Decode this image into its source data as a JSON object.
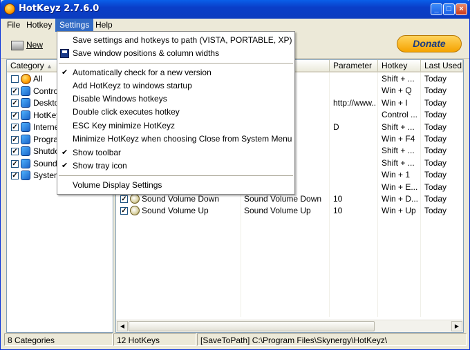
{
  "window": {
    "title": "HotKeyz 2.7.6.0"
  },
  "menubar": {
    "items": [
      "File",
      "Hotkey",
      "Settings",
      "Help"
    ]
  },
  "toolbar": {
    "new_label": "New",
    "donate_label": "Donate"
  },
  "categories": {
    "header": "Category",
    "items": [
      {
        "label": "All",
        "checked": false
      },
      {
        "label": "Contro",
        "checked": true
      },
      {
        "label": "Deskto",
        "checked": true
      },
      {
        "label": "HotKey",
        "checked": true
      },
      {
        "label": "Interne",
        "checked": true
      },
      {
        "label": "Progra",
        "checked": true
      },
      {
        "label": "Shutdo",
        "checked": true
      },
      {
        "label": "Sound",
        "checked": true
      },
      {
        "label": "System",
        "checked": true
      }
    ]
  },
  "hotkeys": {
    "headers": {
      "parameter": "Parameter",
      "hotkey": "Hotkey",
      "last_used": "Last Used"
    },
    "rows": [
      {
        "name": "",
        "command": "",
        "parameter": "",
        "hotkey": "Shift + ...",
        "last_used": "Today"
      },
      {
        "name": "",
        "command": "",
        "parameter": "",
        "hotkey": "Win + Q",
        "last_used": "Today"
      },
      {
        "name": "",
        "command": "",
        "parameter": "http://www....",
        "hotkey": "Win + I",
        "last_used": "Today"
      },
      {
        "name": "",
        "command": "s\\Mozi...",
        "parameter": "",
        "hotkey": "Control ...",
        "last_used": "Today"
      },
      {
        "name": "",
        "command": "",
        "parameter": "D",
        "hotkey": "Shift + ...",
        "last_used": "Today"
      },
      {
        "name": "",
        "command": "ands",
        "parameter": "",
        "hotkey": "Win + F4",
        "last_used": "Today"
      },
      {
        "name": "",
        "command": "",
        "parameter": "",
        "hotkey": "Shift + ...",
        "last_used": "Today"
      },
      {
        "name": "",
        "command": "",
        "parameter": "",
        "hotkey": "Shift + ...",
        "last_used": "Today"
      },
      {
        "name": "",
        "command": "",
        "parameter": "",
        "hotkey": "Win + 1",
        "last_used": "Today"
      },
      {
        "name": "",
        "command": "",
        "parameter": "",
        "hotkey": "Win + E...",
        "last_used": "Today"
      },
      {
        "name": "Sound Volume Down",
        "command": "Sound Volume Down",
        "parameter": "10",
        "hotkey": "Win + D...",
        "last_used": "Today"
      },
      {
        "name": "Sound Volume Up",
        "command": "Sound Volume Up",
        "parameter": "10",
        "hotkey": "Win + Up",
        "last_used": "Today"
      }
    ]
  },
  "settings_menu": {
    "items": [
      {
        "label": "Save settings and hotkeys to path (VISTA, PORTABLE, XP)",
        "checked": false
      },
      {
        "label": "Save window positions & column widths",
        "checked": false,
        "icon": "floppy-icon"
      },
      {
        "label": "Automatically check for a new version",
        "checked": true
      },
      {
        "label": "Add HotKeyz to windows startup",
        "checked": false
      },
      {
        "label": "Disable Windows hotkeys",
        "checked": false
      },
      {
        "label": "Double click executes hotkey",
        "checked": false
      },
      {
        "label": "ESC Key minimize HotKeyz",
        "checked": false
      },
      {
        "label": "Minimize HotKeyz when choosing Close from System Menu",
        "checked": false
      },
      {
        "label": "Show toolbar",
        "checked": true
      },
      {
        "label": "Show tray icon",
        "checked": true
      },
      {
        "label": "Volume Display Settings",
        "checked": false
      }
    ]
  },
  "statusbar": {
    "categories": "8 Categories",
    "hotkeys": "12 HotKeys",
    "path": "[SaveToPath] C:\\Program Files\\Skynergy\\HotKeyz\\"
  }
}
